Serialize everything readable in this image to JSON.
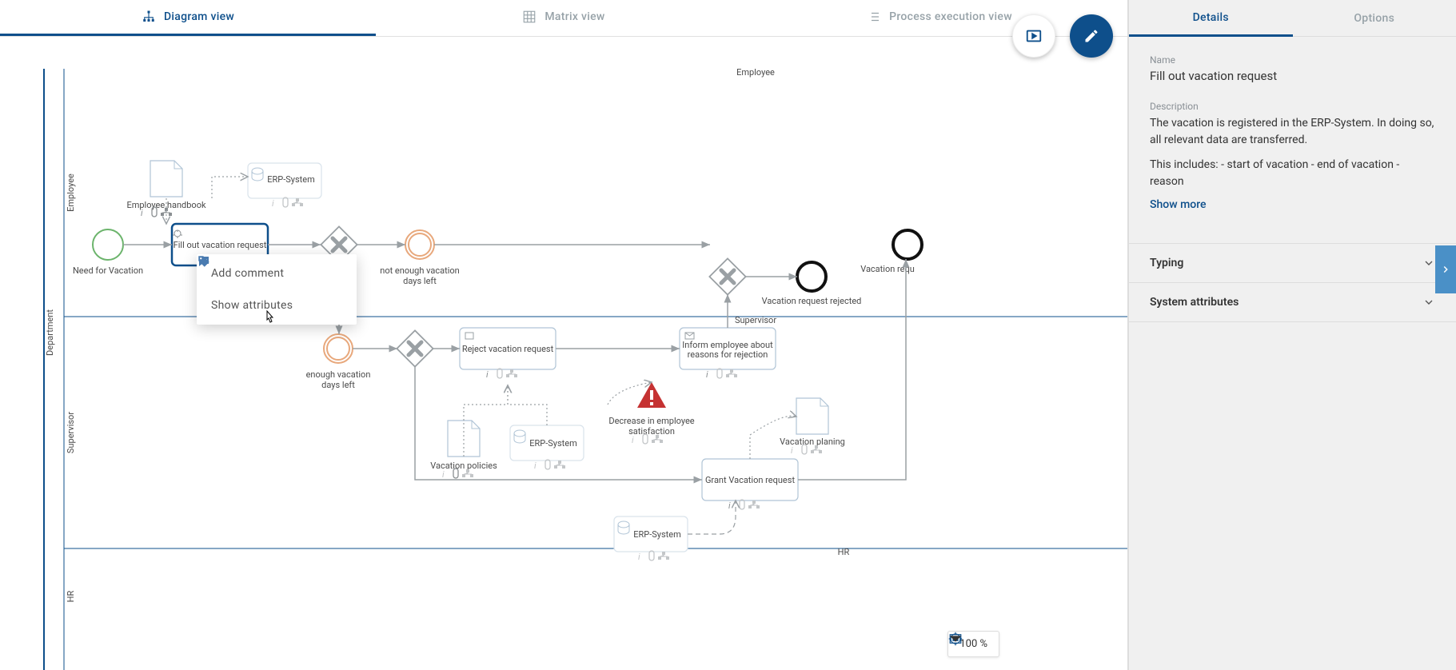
{
  "viewTabs": {
    "diagram": "Diagram view",
    "matrix": "Matrix view",
    "process": "Process execution view"
  },
  "pool": {
    "name": "Department",
    "lanes": {
      "employee": "Employee",
      "supervisor": "Supervisor",
      "hr": "HR"
    }
  },
  "nodes": {
    "needForVacation": "Need for Vacation",
    "employeeHandbook": "Employee handbook",
    "erp1": "ERP-System",
    "fillOutRequest": "Fill out vacation request",
    "notEnoughDays1": "not enough vacation",
    "notEnoughDays2": "days left",
    "enoughDays1": "enough vacation",
    "enoughDays2": "days left",
    "rejectRequest": "Reject vacation request",
    "informEmployee1": "Inform employee about",
    "informEmployee2": "reasons for rejection",
    "vacationRejected": "Vacation request rejected",
    "vacationReq": "Vacation requ",
    "decreaseSat1": "Decrease in employee",
    "decreaseSat2": "satisfaction",
    "vacationPolicies": "Vacation policies",
    "erp2": "ERP-System",
    "vacationPlaning": "Vacation planing",
    "grantRequest": "Grant Vacation request",
    "erp3": "ERP-System"
  },
  "contextMenu": {
    "addComment": "Add comment",
    "showAttributes": "Show attributes"
  },
  "zoom": {
    "level": "100 %"
  },
  "side": {
    "tabs": {
      "details": "Details",
      "options": "Options"
    },
    "nameLabel": "Name",
    "nameValue": "Fill out vacation request",
    "descLabel": "Description",
    "desc1": "The vacation is registered in the ERP-System. In doing so, all relevant data are transferred.",
    "desc2": "This includes: - start of vacation - end of vacation - reason",
    "showMore": "Show more",
    "typing": "Typing",
    "systemAttributes": "System attributes"
  }
}
